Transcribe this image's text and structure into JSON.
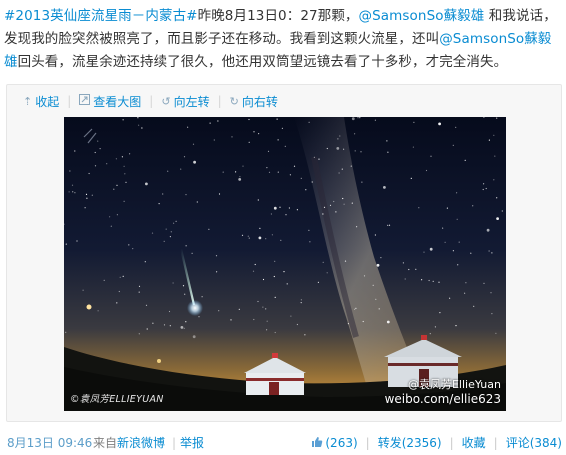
{
  "post": {
    "topic": "#2013英仙座流星雨－内蒙古#",
    "text_1": "昨晚8月13日0：27那颗，",
    "mention_1": "@SamsonSo蘇毅雄",
    "text_2": " 和我说话，发现我的脸突然被照亮了，而且影子还在移动。我看到这颗火流星，还叫",
    "mention_2": "@SamsonSo蘇毅雄",
    "text_3": "回头看，流星余迹还持续了很久，他还用双筒望远镜去看了十多秒，才完全消失。"
  },
  "media_toolbar": {
    "collapse": "收起",
    "view_large": "查看大图",
    "rotate_left": "向左转",
    "rotate_right": "向右转"
  },
  "photo": {
    "watermark_left": "©袁凤芳ELLIEYUAN",
    "watermark_right_name": "@袁凤芳EllieYuan",
    "watermark_right_url": "weibo.com/ellie623"
  },
  "footer": {
    "time": "8月13日 09:46",
    "from_label": "来自",
    "source": "新浪微博",
    "report": "举报",
    "like_count": "(263)",
    "repost": "转发(2356)",
    "favorite": "收藏",
    "comment": "评论(384)"
  },
  "colors": {
    "link": "#0a8cd2",
    "time": "#5c9ec9",
    "meta": "#808080"
  },
  "icons": {
    "collapse": "arrow-up-icon",
    "view_large": "magnify-icon",
    "rotate_left": "rotate-left-icon",
    "rotate_right": "rotate-right-icon",
    "like": "thumbs-up-icon"
  }
}
